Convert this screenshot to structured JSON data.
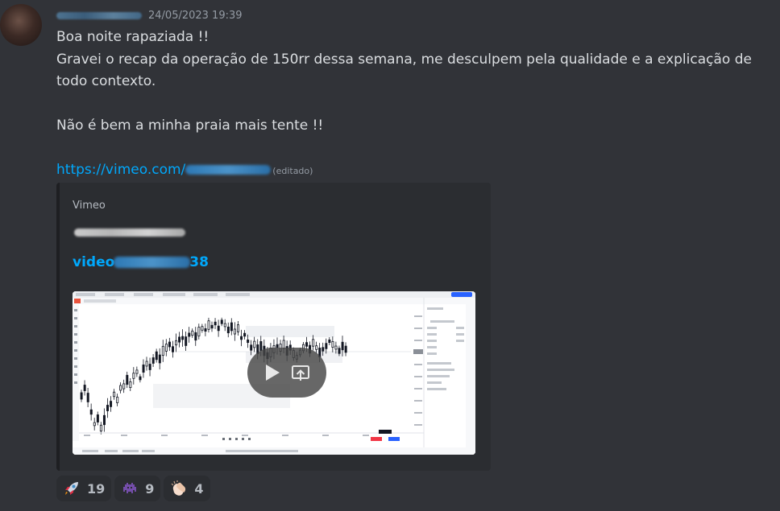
{
  "message": {
    "timestamp": "24/05/2023 19:39",
    "line1": "Boa noite rapaziada !!",
    "line2": "Gravei o recap da operação de 150rr dessa semana, me desculpem pela qualidade e a explicação de todo contexto.",
    "line3": "Não é bem a minha praia mais tente !!",
    "link_prefix": "https://vimeo.com/",
    "link_suffix": "",
    "edited": "(editado)"
  },
  "embed": {
    "provider": "Vimeo",
    "title_prefix": "video",
    "title_suffix": "38"
  },
  "reactions": [
    {
      "emoji": "rocket",
      "count": "19"
    },
    {
      "emoji": "alien-monster",
      "count": "9"
    },
    {
      "emoji": "clapping-hands",
      "count": "4"
    }
  ],
  "colors": {
    "background": "#313338",
    "embed_bg": "#2b2d31",
    "link": "#00a8fc"
  }
}
